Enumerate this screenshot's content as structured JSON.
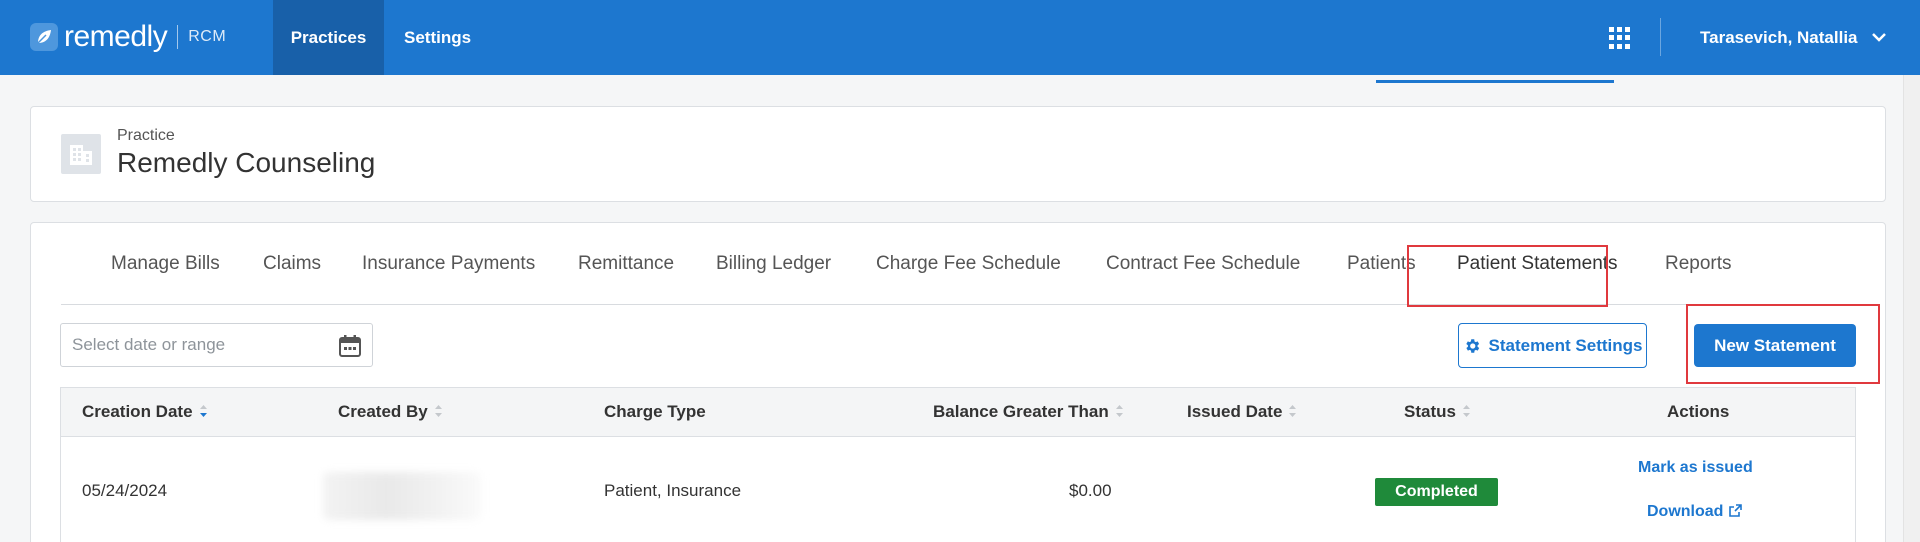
{
  "header": {
    "brand": "remedly",
    "brand_sub": "RCM",
    "nav": [
      "Practices",
      "Settings"
    ],
    "user_name": "Tarasevich, Natallia"
  },
  "practice": {
    "kicker": "Practice",
    "name": "Remedly Counseling"
  },
  "tabs": [
    "Manage Bills",
    "Claims",
    "Insurance Payments",
    "Remittance",
    "Billing Ledger",
    "Charge Fee Schedule",
    "Contract Fee Schedule",
    "Patients",
    "Patient Statements",
    "Reports"
  ],
  "active_tab": "Patient Statements",
  "date_filter": {
    "placeholder": "Select date or range"
  },
  "buttons": {
    "statement_settings": "Statement Settings",
    "new_statement": "New Statement"
  },
  "table": {
    "columns": [
      "Creation Date",
      "Created By",
      "Charge Type",
      "Balance Greater Than",
      "Issued Date",
      "Status",
      "Actions"
    ],
    "rows": [
      {
        "creation_date": "05/24/2024",
        "created_by": "",
        "charge_type": "Patient, Insurance",
        "balance_greater_than": "$0.00",
        "issued_date": "",
        "status": "Completed",
        "actions": [
          "Mark as issued",
          "Download"
        ]
      }
    ]
  },
  "colors": {
    "brand_blue": "#1d77cf",
    "nav_active": "#1860a9",
    "status_completed": "#1f8a3a",
    "highlight_red": "#e0393e"
  }
}
